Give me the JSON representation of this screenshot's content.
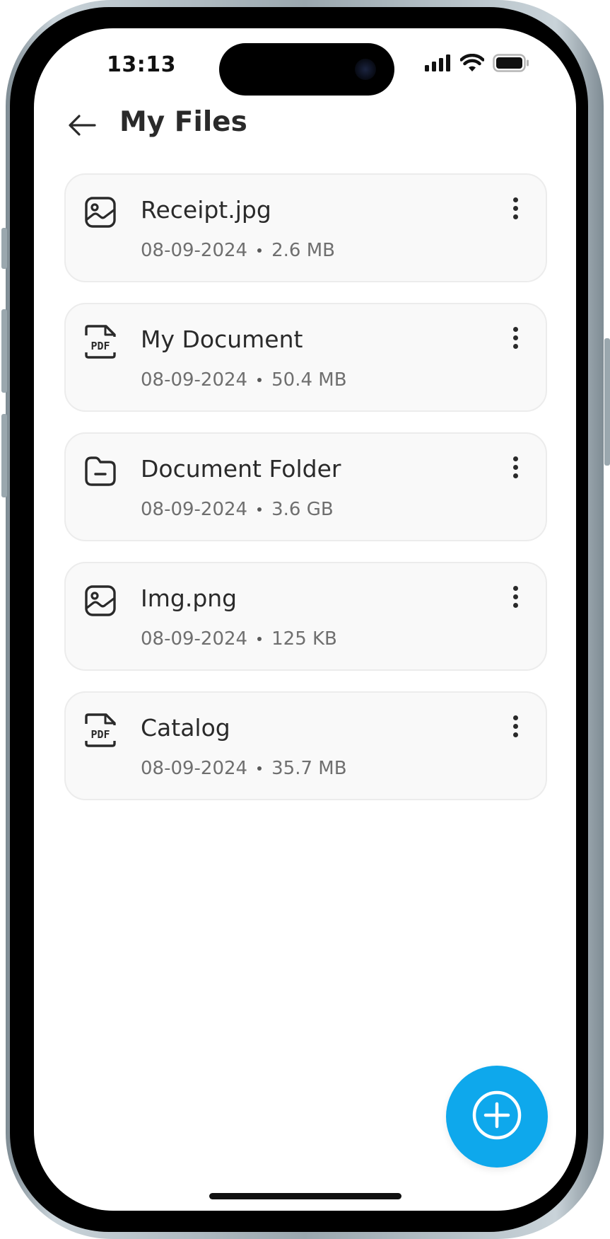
{
  "status_bar": {
    "time": "13:13"
  },
  "header": {
    "title": "My Files"
  },
  "files": [
    {
      "name": "Receipt.jpg",
      "date": "08-09-2024",
      "size": "2.6 MB",
      "type_icon": "image-icon"
    },
    {
      "name": "My Document",
      "date": "08-09-2024",
      "size": "50.4 MB",
      "type_icon": "pdf-icon"
    },
    {
      "name": "Document Folder",
      "date": "08-09-2024",
      "size": "3.6 GB",
      "type_icon": "folder-icon"
    },
    {
      "name": "Img.png",
      "date": "08-09-2024",
      "size": "125 KB",
      "type_icon": "image-icon"
    },
    {
      "name": "Catalog",
      "date": "08-09-2024",
      "size": "35.7 MB",
      "type_icon": "pdf-icon"
    }
  ],
  "colors": {
    "accent": "#0ea8ec",
    "card_background": "#f9f9f9",
    "text_primary": "#2a2a2a",
    "text_secondary": "#6f6f6f"
  }
}
